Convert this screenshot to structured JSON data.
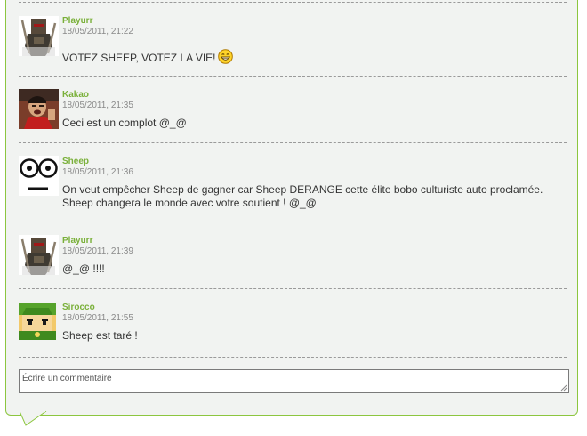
{
  "comments": [
    {
      "author": "Playurr",
      "date": "18/05/2011, 21:22",
      "text": "VOTEZ SHEEP, VOTEZ LA VIE!",
      "avatar": "warrior-avatar",
      "emoticon": "grin-smiley-icon"
    },
    {
      "author": "Kakao",
      "date": "18/05/2011, 21:35",
      "text": "Ceci est un complot @_@",
      "avatar": "photo-avatar"
    },
    {
      "author": "Sheep",
      "date": "18/05/2011, 21:36",
      "text": "On veut empêcher Sheep de gagner car Sheep DERANGE cette élite bobo culturiste auto proclamée. Sheep changera le monde avec votre soutient ! @_@",
      "avatar": "sheep-eyes-avatar"
    },
    {
      "author": "Playurr",
      "date": "18/05/2011, 21:39",
      "text": "@_@ !!!!",
      "avatar": "warrior-avatar"
    },
    {
      "author": "Sirocco",
      "date": "18/05/2011, 21:55",
      "text": "Sheep est taré !",
      "avatar": "link-cartoon-avatar"
    }
  ],
  "comment_box": {
    "placeholder": "Écrire un commentaire",
    "value": ""
  },
  "colors": {
    "author": "#7ab03a",
    "panel_border": "#8cc63f",
    "panel_bg": "#f1f3f1"
  }
}
